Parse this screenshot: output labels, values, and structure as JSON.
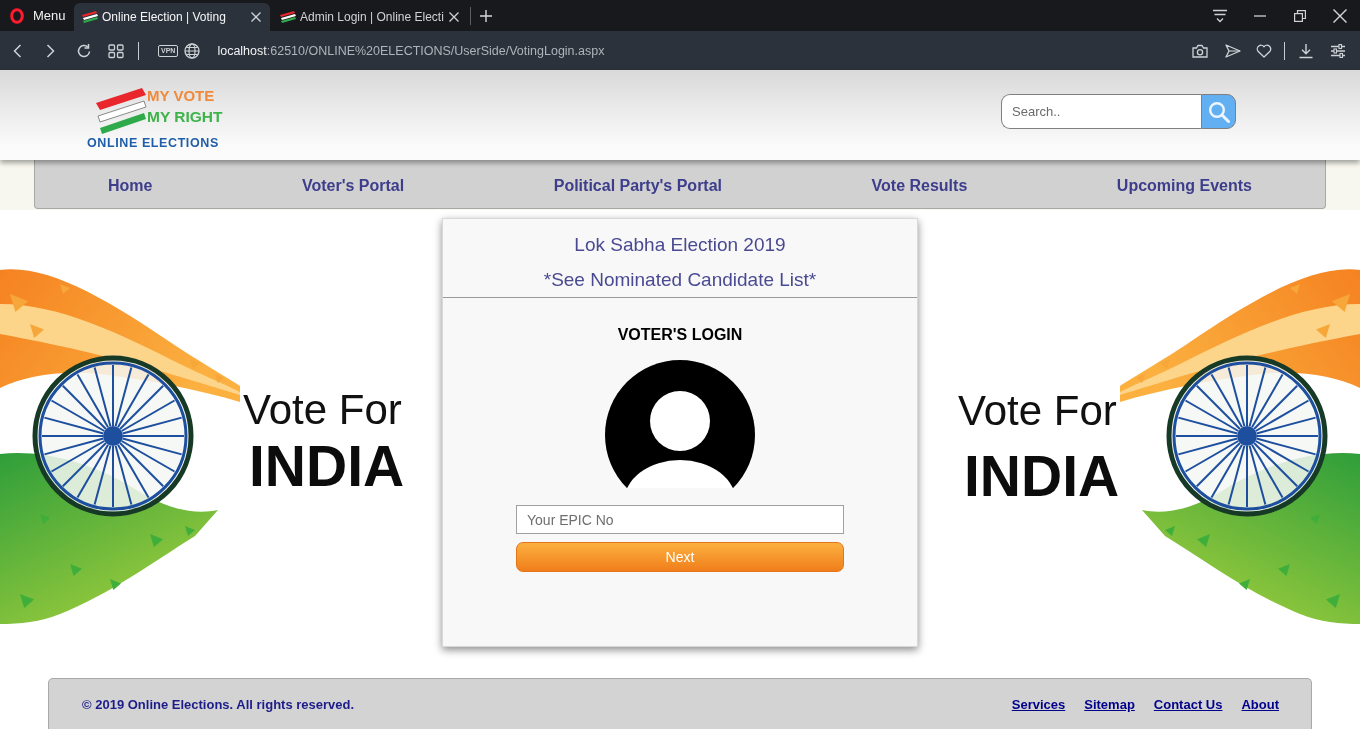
{
  "browser": {
    "menu_label": "Menu",
    "tabs": [
      {
        "title": "Online Election | Voting",
        "selected": true
      },
      {
        "title": "Admin Login | Online Electi",
        "selected": false
      }
    ],
    "vpn_badge": "VPN",
    "address": {
      "host": "localhost",
      "path": ":62510/ONLINE%20ELECTIONS/UserSide/VotingLogin.aspx"
    }
  },
  "header": {
    "logo": {
      "line_1": "MY VOTE",
      "line_2": "MY RIGHT",
      "tagline": "ONLINE ELECTIONS"
    },
    "search": {
      "placeholder": "Search.."
    }
  },
  "nav": [
    "Home",
    "Voter's Portal",
    "Political Party's Portal",
    "Vote Results",
    "Upcoming Events"
  ],
  "banners": [
    {
      "line_1": "Vote For",
      "line_2": "INDIA"
    },
    {
      "line_1": "Vote For",
      "line_2": "INDIA"
    }
  ],
  "login_card": {
    "title": "Lok Sabha Election 2019",
    "candidate_link": "*See Nominated Candidate List*",
    "heading": "VOTER'S LOGIN",
    "epic_field": {
      "placeholder": "Your EPIC No"
    },
    "next_button": "Next"
  },
  "footer": {
    "copyright": "© 2019 Online Elections. All rights reserved.",
    "links": [
      "Services",
      "Sitemap",
      "Contact Us",
      "About"
    ]
  }
}
